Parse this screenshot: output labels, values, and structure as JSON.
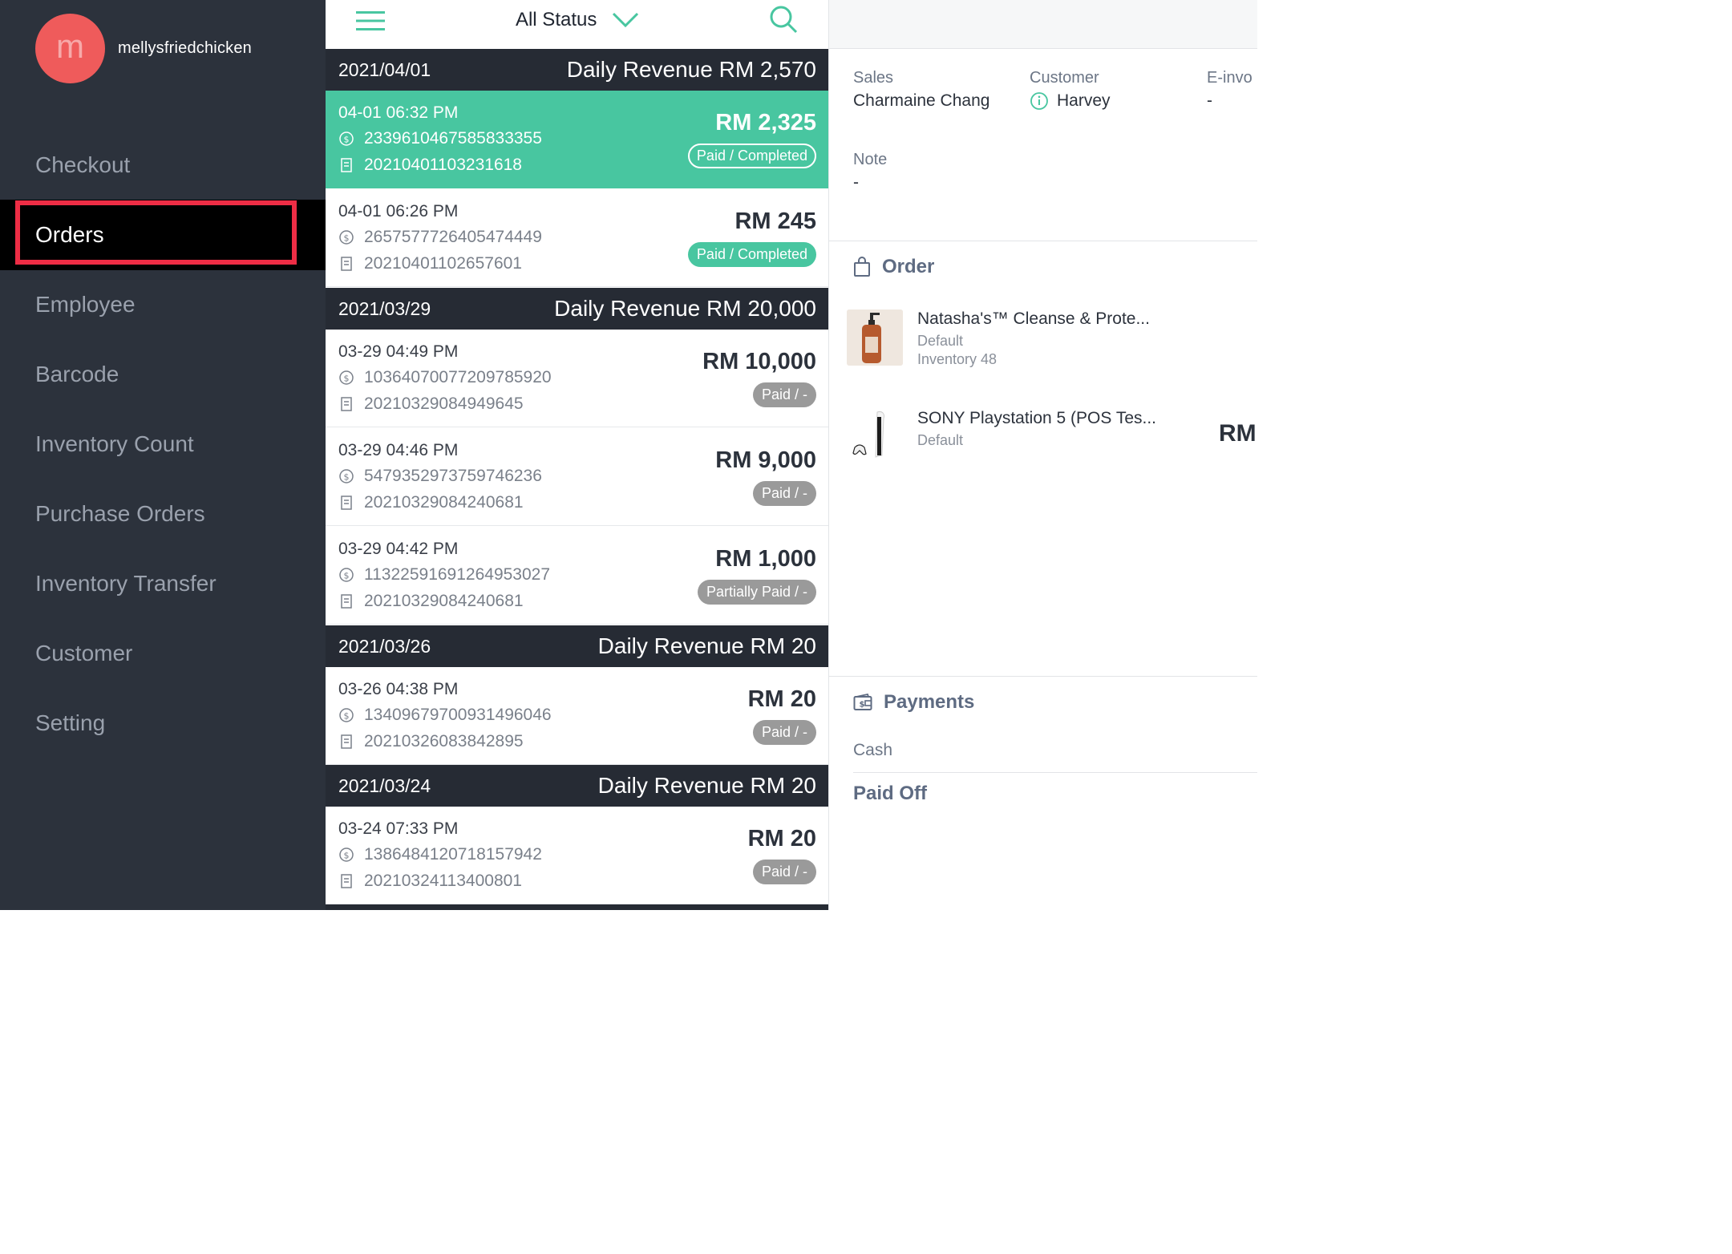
{
  "profile": {
    "avatar_letter": "m",
    "username": "mellysfriedchicken"
  },
  "nav": [
    {
      "label": "Checkout"
    },
    {
      "label": "Orders"
    },
    {
      "label": "Employee"
    },
    {
      "label": "Barcode"
    },
    {
      "label": "Inventory Count"
    },
    {
      "label": "Purchase Orders"
    },
    {
      "label": "Inventory Transfer"
    },
    {
      "label": "Customer"
    },
    {
      "label": "Setting"
    }
  ],
  "active_nav": "Orders",
  "topbar": {
    "status_filter": "All Status"
  },
  "groups": [
    {
      "date": "2021/04/01",
      "revenue": "Daily Revenue RM 2,570"
    },
    {
      "date": "2021/03/29",
      "revenue": "Daily Revenue RM 20,000"
    },
    {
      "date": "2021/03/26",
      "revenue": "Daily Revenue RM 20"
    },
    {
      "date": "2021/03/24",
      "revenue": "Daily Revenue RM 20"
    }
  ],
  "orders": [
    {
      "time": "04-01 06:32 PM",
      "payment_id": "2339610467585833355",
      "receipt_no": "20210401103231618",
      "amount": "RM 2,325",
      "status": "Paid / Completed",
      "selected": true
    },
    {
      "time": "04-01 06:26 PM",
      "payment_id": "2657577726405474449",
      "receipt_no": "20210401102657601",
      "amount": "RM 245",
      "status": "Paid / Completed"
    },
    {
      "time": "03-29 04:49 PM",
      "payment_id": "1036407007720978592​0",
      "receipt_no": "20210329084949645",
      "amount": "RM 10,000",
      "status": "Paid / -"
    },
    {
      "time": "03-29 04:46 PM",
      "payment_id": "5479352973759746236",
      "receipt_no": "20210329084240681",
      "amount": "RM 9,000",
      "status": "Paid / -"
    },
    {
      "time": "03-29 04:42 PM",
      "payment_id": "11322591691264953027",
      "receipt_no": "20210329084240681",
      "amount": "RM 1,000",
      "status": "Partially Paid / -"
    },
    {
      "time": "03-26 04:38 PM",
      "payment_id": "13409679700931496046",
      "receipt_no": "20210326083842895",
      "amount": "RM 20",
      "status": "Paid / -"
    },
    {
      "time": "03-24 07:33 PM",
      "payment_id": "13864841207181579​42",
      "receipt_no": "20210324113400801",
      "amount": "RM 20",
      "status": "Paid / -"
    }
  ],
  "details": {
    "sales_label": "Sales",
    "sales_value": "Charmaine Chang",
    "customer_label": "Customer",
    "customer_value": "Harvey",
    "einvoice_label": "E-invo",
    "einvoice_value": "-",
    "note_label": "Note",
    "note_value": "-",
    "order_title": "Order",
    "items": [
      {
        "name": "Natasha's™ Cleanse & Prote...",
        "variant": "Default",
        "inventory": "Inventory 48"
      },
      {
        "name": "SONY Playstation 5 (POS Tes...",
        "variant": "Default",
        "price": "RM"
      }
    ],
    "payments_title": "Payments",
    "payment_method": "Cash",
    "paid_off": "Paid Off"
  },
  "colors": {
    "sidebar": "#2c323c",
    "accent": "#48c6a0",
    "highlight": "#ee2d45",
    "avatar": "#ef5b5b"
  }
}
